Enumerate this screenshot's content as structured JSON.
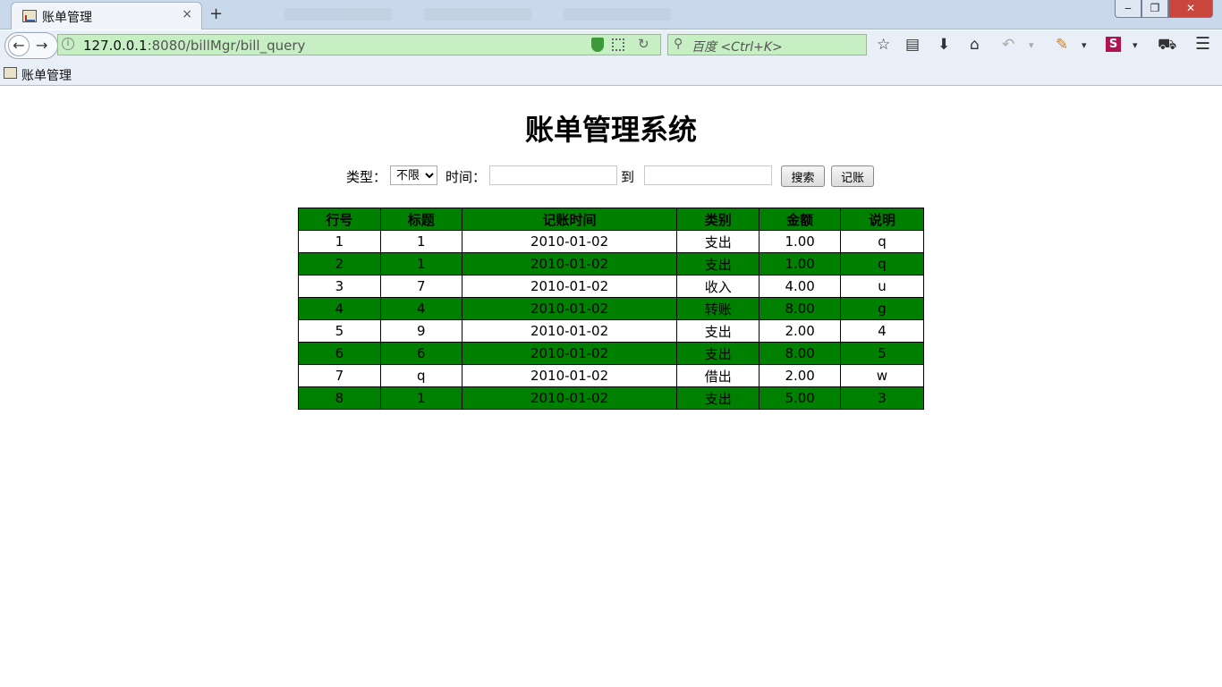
{
  "browser": {
    "tab_title": "账单管理",
    "tab_close": "×",
    "new_tab": "+",
    "url_host": "127.0.0.1",
    "url_rest": ":8080/billMgr/bill_query",
    "search_placeholder": "百度 <Ctrl+K>",
    "bookmark_label": "账单管理",
    "icons": [
      "back-icon",
      "forward-icon",
      "info-icon",
      "shield-icon",
      "qr-icon",
      "reload-icon",
      "search-icon",
      "star-icon",
      "reader-icon",
      "download-icon",
      "home-icon",
      "undo-icon",
      "extension-icon",
      "s-icon",
      "train-icon",
      "menu-icon"
    ]
  },
  "page": {
    "title": "账单管理系统",
    "filters": {
      "type_label": "类型：",
      "type_selected": "不限",
      "time_label": "时间：",
      "to_label": "到",
      "start_value": "",
      "end_value": "",
      "search_button": "搜索",
      "record_button": "记账"
    },
    "table": {
      "headers": [
        "行号",
        "标题",
        "记账时间",
        "类别",
        "金额",
        "说明"
      ],
      "rows": [
        [
          "1",
          "1",
          "2010-01-02",
          "支出",
          "1.00",
          "q"
        ],
        [
          "2",
          "1",
          "2010-01-02",
          "支出",
          "1.00",
          "q"
        ],
        [
          "3",
          "7",
          "2010-01-02",
          "收入",
          "4.00",
          "u"
        ],
        [
          "4",
          "4",
          "2010-01-02",
          "转账",
          "8.00",
          "g"
        ],
        [
          "5",
          "9",
          "2010-01-02",
          "支出",
          "2.00",
          "4"
        ],
        [
          "6",
          "6",
          "2010-01-02",
          "支出",
          "8.00",
          "5"
        ],
        [
          "7",
          "q",
          "2010-01-02",
          "借出",
          "2.00",
          "w"
        ],
        [
          "8",
          "1",
          "2010-01-02",
          "支出",
          "5.00",
          "3"
        ]
      ],
      "alt_row_color": "#008000",
      "header_color": "#008000"
    }
  }
}
